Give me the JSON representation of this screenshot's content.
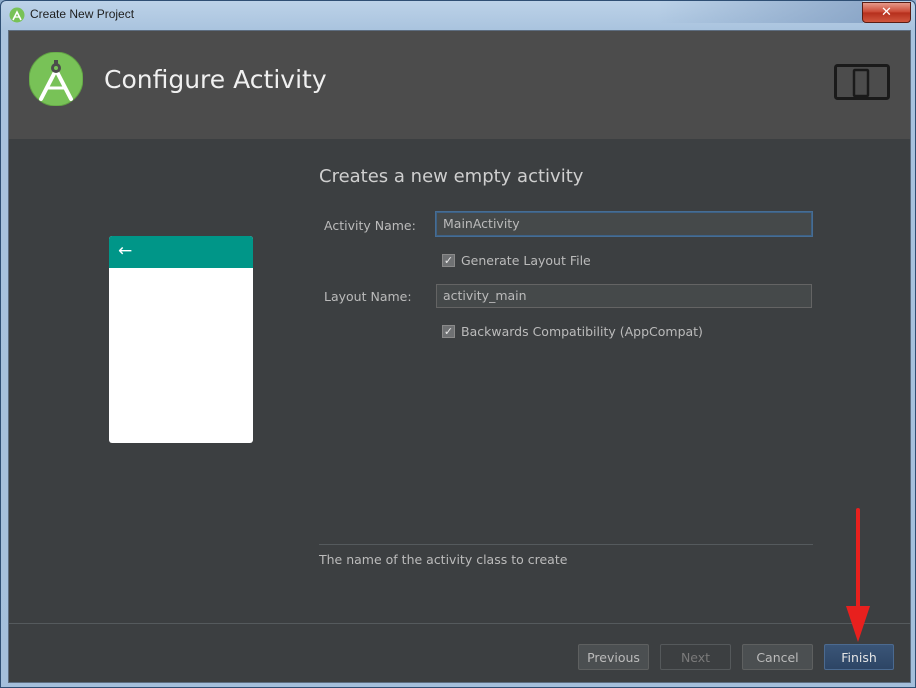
{
  "window": {
    "title": "Create New Project",
    "close_label": "✕"
  },
  "header": {
    "title": "Configure Activity"
  },
  "main": {
    "subtitle": "Creates a new empty activity",
    "activity_name_label": "Activity Name:",
    "activity_name_value": "MainActivity",
    "generate_layout_label": "Generate Layout File",
    "generate_layout_checked": true,
    "layout_name_label": "Layout Name:",
    "layout_name_value": "activity_main",
    "backwards_compat_label": "Backwards Compatibility (AppCompat)",
    "backwards_compat_checked": true,
    "help_text": "The name of the activity class to create",
    "check_mark": "✓",
    "preview_back_glyph": "←"
  },
  "footer": {
    "previous_label": "Previous",
    "next_label": "Next",
    "cancel_label": "Cancel",
    "finish_label": "Finish"
  },
  "colors": {
    "accent": "#009688",
    "annotation_arrow": "#e8201e",
    "logo_green": "#78c257"
  }
}
